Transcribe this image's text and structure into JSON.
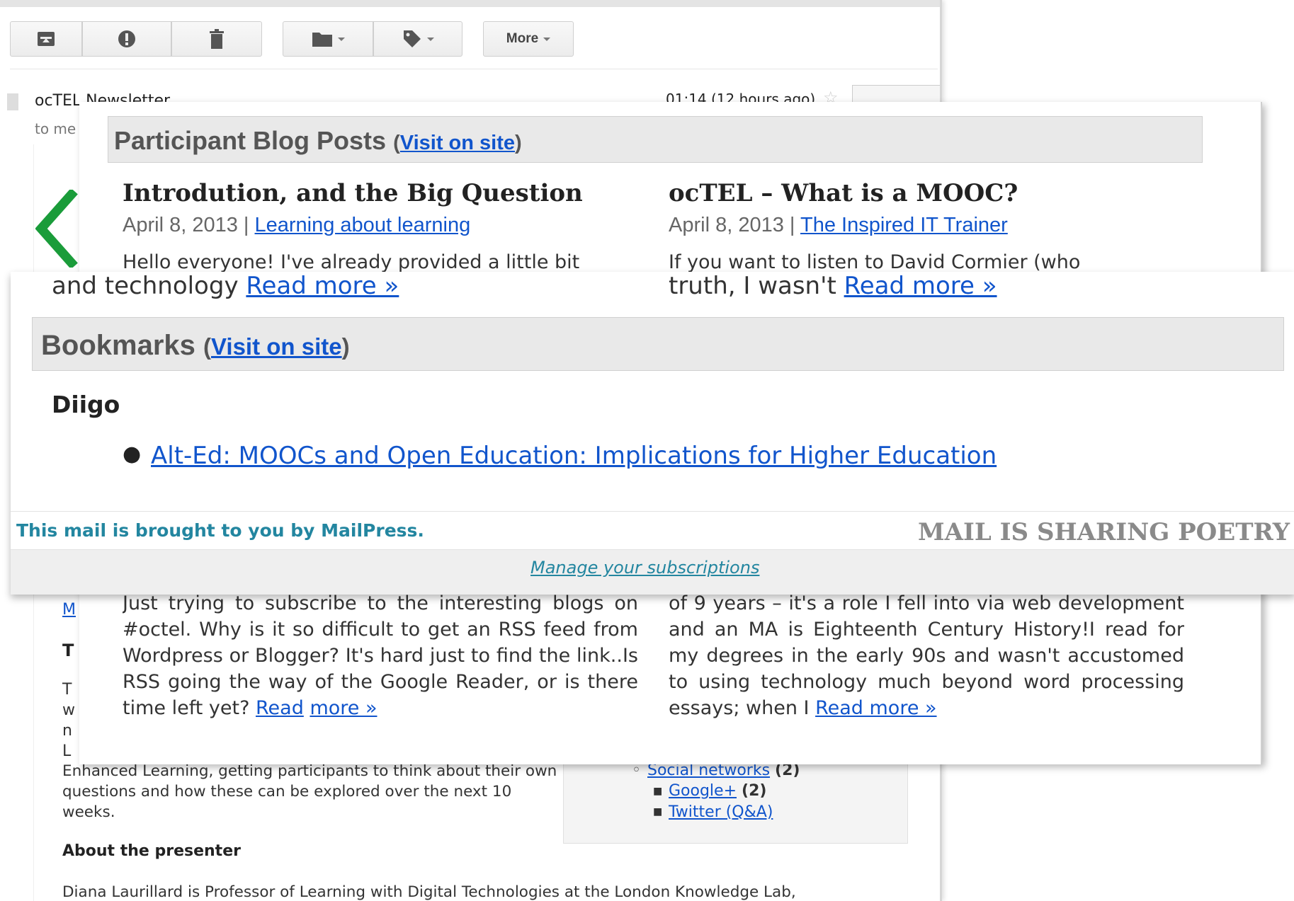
{
  "gmail": {
    "toolbar": {
      "more_label": "More"
    },
    "sender": "ocTEL Newsletter",
    "to": "to me",
    "date": "01:14 (12 hours ago)",
    "fragment_m": "M",
    "fragment_t": "T",
    "description": "Enhanced Learning, getting participants to think about their own questions and how these can be explored over the next 10 weeks.",
    "about_title": "About the presenter",
    "about_text": "Diana Laurillard is Professor of Learning with Digital Technologies at the London Knowledge Lab,",
    "side_links": {
      "social": "Social networks",
      "social_count": "(2)",
      "google": "Google+",
      "google_count": "(2)",
      "twitter": "Twitter (Q&A)"
    }
  },
  "blog_posts": {
    "header": "Participant Blog Posts",
    "visit": "Visit on site",
    "open_paren": "(",
    "close_paren": ")",
    "posts": [
      {
        "title": "Introdution, and the Big Question",
        "date": "April 8, 2013",
        "sep": "|",
        "source": "Learning about learning",
        "excerpt": "Hello everyone! I've already provided a little bit"
      },
      {
        "title": "ocTEL – What is a MOOC?",
        "date": "April 8, 2013",
        "sep": "|",
        "source": "The Inspired IT Trainer",
        "excerpt": "If you want to listen to David Cormier (who"
      }
    ],
    "lower_left_excerpt": "Just trying to subscribe to the interesting blogs on #octel. Why is it so difficult to get an RSS feed from Wordpress or Blogger? It's hard just to find the link..Is RSS going the way of the Google Reader, or is there time left yet?",
    "lower_right_excerpt": "of 9 years – it's a role I fell into via web development and an MA is Eighteenth Century History!I read for my degrees in the early 90s and wasn't accustomed to using technology much beyond word processing essays; when I",
    "read_more": "Read more »",
    "read": "Read",
    "more": "more »"
  },
  "bookmarks": {
    "cont_left": "and technology",
    "cont_right": "truth, I wasn't",
    "read_more": "Read more »",
    "header": "Bookmarks",
    "visit": "Visit on site",
    "open_paren": "(",
    "close_paren": ")",
    "service": "Diigo",
    "items": [
      "Alt-Ed: MOOCs and Open Education: Implications for Higher Education"
    ],
    "footer_credit": "This mail is brought to you by MailPress.",
    "tagline": "MAIL IS SHARING POETRY",
    "manage": "Manage your subscriptions"
  }
}
